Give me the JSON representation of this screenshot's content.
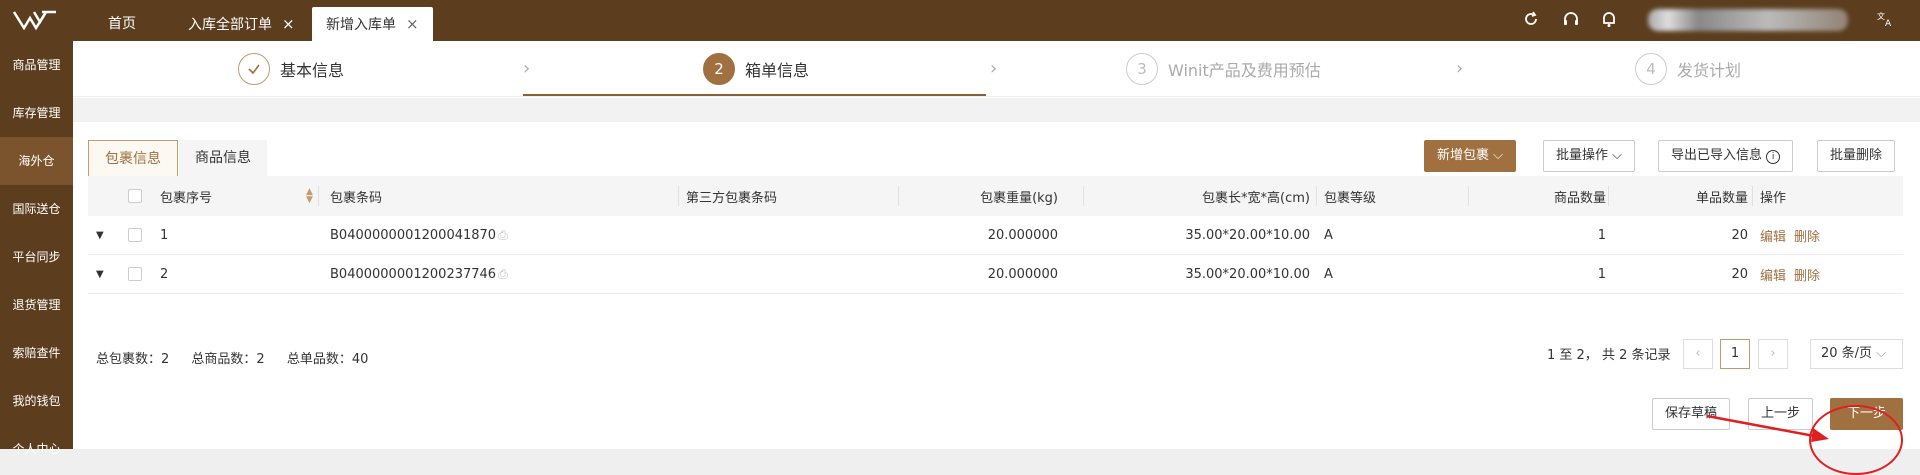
{
  "topbar": {
    "tabs": [
      {
        "label": "首页"
      },
      {
        "label": "入库全部订单",
        "close": "×"
      },
      {
        "label": "新增入库单",
        "close": "×"
      }
    ]
  },
  "sidebar": {
    "items": [
      {
        "label": "商品管理"
      },
      {
        "label": "库存管理"
      },
      {
        "label": "海外仓"
      },
      {
        "label": "国际送仓"
      },
      {
        "label": "平台同步"
      },
      {
        "label": "退货管理"
      },
      {
        "label": "索赔查件"
      },
      {
        "label": "我的钱包"
      },
      {
        "label": "个人中心"
      }
    ],
    "active_index": 2
  },
  "steps": [
    {
      "number": "✓",
      "label": "基本信息",
      "state": "done"
    },
    {
      "number": "2",
      "label": "箱单信息",
      "state": "active"
    },
    {
      "number": "3",
      "label": "Winit产品及费用预估",
      "state": "pending"
    },
    {
      "number": "4",
      "label": "发货计划",
      "state": "pending"
    }
  ],
  "subtabs": [
    {
      "label": "包裹信息",
      "active": true
    },
    {
      "label": "商品信息",
      "active": false
    }
  ],
  "toolbar": {
    "add_package": "新增包裹",
    "batch_ops": "批量操作",
    "export_imported": "导出已导入信息",
    "batch_delete": "批量删除"
  },
  "table": {
    "headers": {
      "seq": "包裹序号",
      "barcode": "包裹条码",
      "third_barcode": "第三方包裹条码",
      "weight": "包裹重量(kg)",
      "dims": "包裹长*宽*高(cm)",
      "grade": "包裹等级",
      "goods_qty": "商品数量",
      "unit_qty": "单品数量",
      "ops": "操作"
    },
    "rows": [
      {
        "seq": "1",
        "barcode": "B0400000001200041870",
        "third_barcode": "",
        "weight": "20.000000",
        "dims": "35.00*20.00*10.00",
        "grade": "A",
        "goods_qty": "1",
        "unit_qty": "20",
        "edit": "编辑",
        "delete": "删除"
      },
      {
        "seq": "2",
        "barcode": "B0400000001200237746",
        "third_barcode": "",
        "weight": "20.000000",
        "dims": "35.00*20.00*10.00",
        "grade": "A",
        "goods_qty": "1",
        "unit_qty": "20",
        "edit": "编辑",
        "delete": "删除"
      }
    ]
  },
  "summary": {
    "total_packages": "总包裹数：2",
    "total_goods": "总商品数：2",
    "total_units": "总单品数：40"
  },
  "pagination": {
    "range_text": "1 至 2， 共 2 条记录",
    "prev": "‹",
    "current": "1",
    "next": "›",
    "page_size": "20 条/页"
  },
  "footer": {
    "save_draft": "保存草稿",
    "prev_step": "上一步",
    "next_step": "下一步"
  },
  "colors": {
    "brand_dark": "#5c3e1f",
    "accent": "#a07040",
    "annotation_red": "#e02020"
  }
}
